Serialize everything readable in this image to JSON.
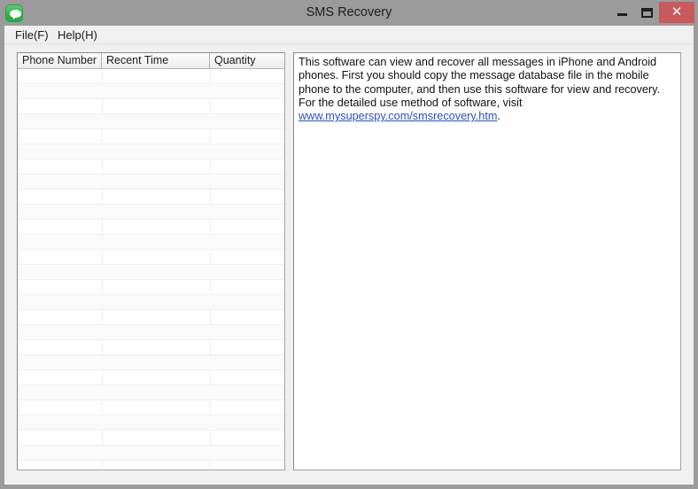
{
  "window": {
    "title": "SMS Recovery",
    "icon": "sms-bubble-icon",
    "controls": {
      "minimize_label": "–",
      "maximize_label": "□",
      "close_label": "✕",
      "close_color": "#c9595b"
    }
  },
  "menubar": {
    "items": [
      {
        "label": "File(F)"
      },
      {
        "label": "Help(H)"
      }
    ]
  },
  "list": {
    "columns": [
      {
        "label": "Phone Number"
      },
      {
        "label": "Recent Time"
      },
      {
        "label": "Quantity"
      }
    ],
    "rows": [],
    "row_count": 0,
    "empty": true
  },
  "info": {
    "text_before_link": "This software can view and recover all messages in iPhone and Android phones. First you should copy the message database file in the mobile phone to the computer, and then use this software for view and recovery. For the detailed use method of software, visit ",
    "link_text": "www.mysuperspy.com/smsrecovery.htm",
    "text_after_link": ".",
    "link_color": "#2a4fc4"
  }
}
